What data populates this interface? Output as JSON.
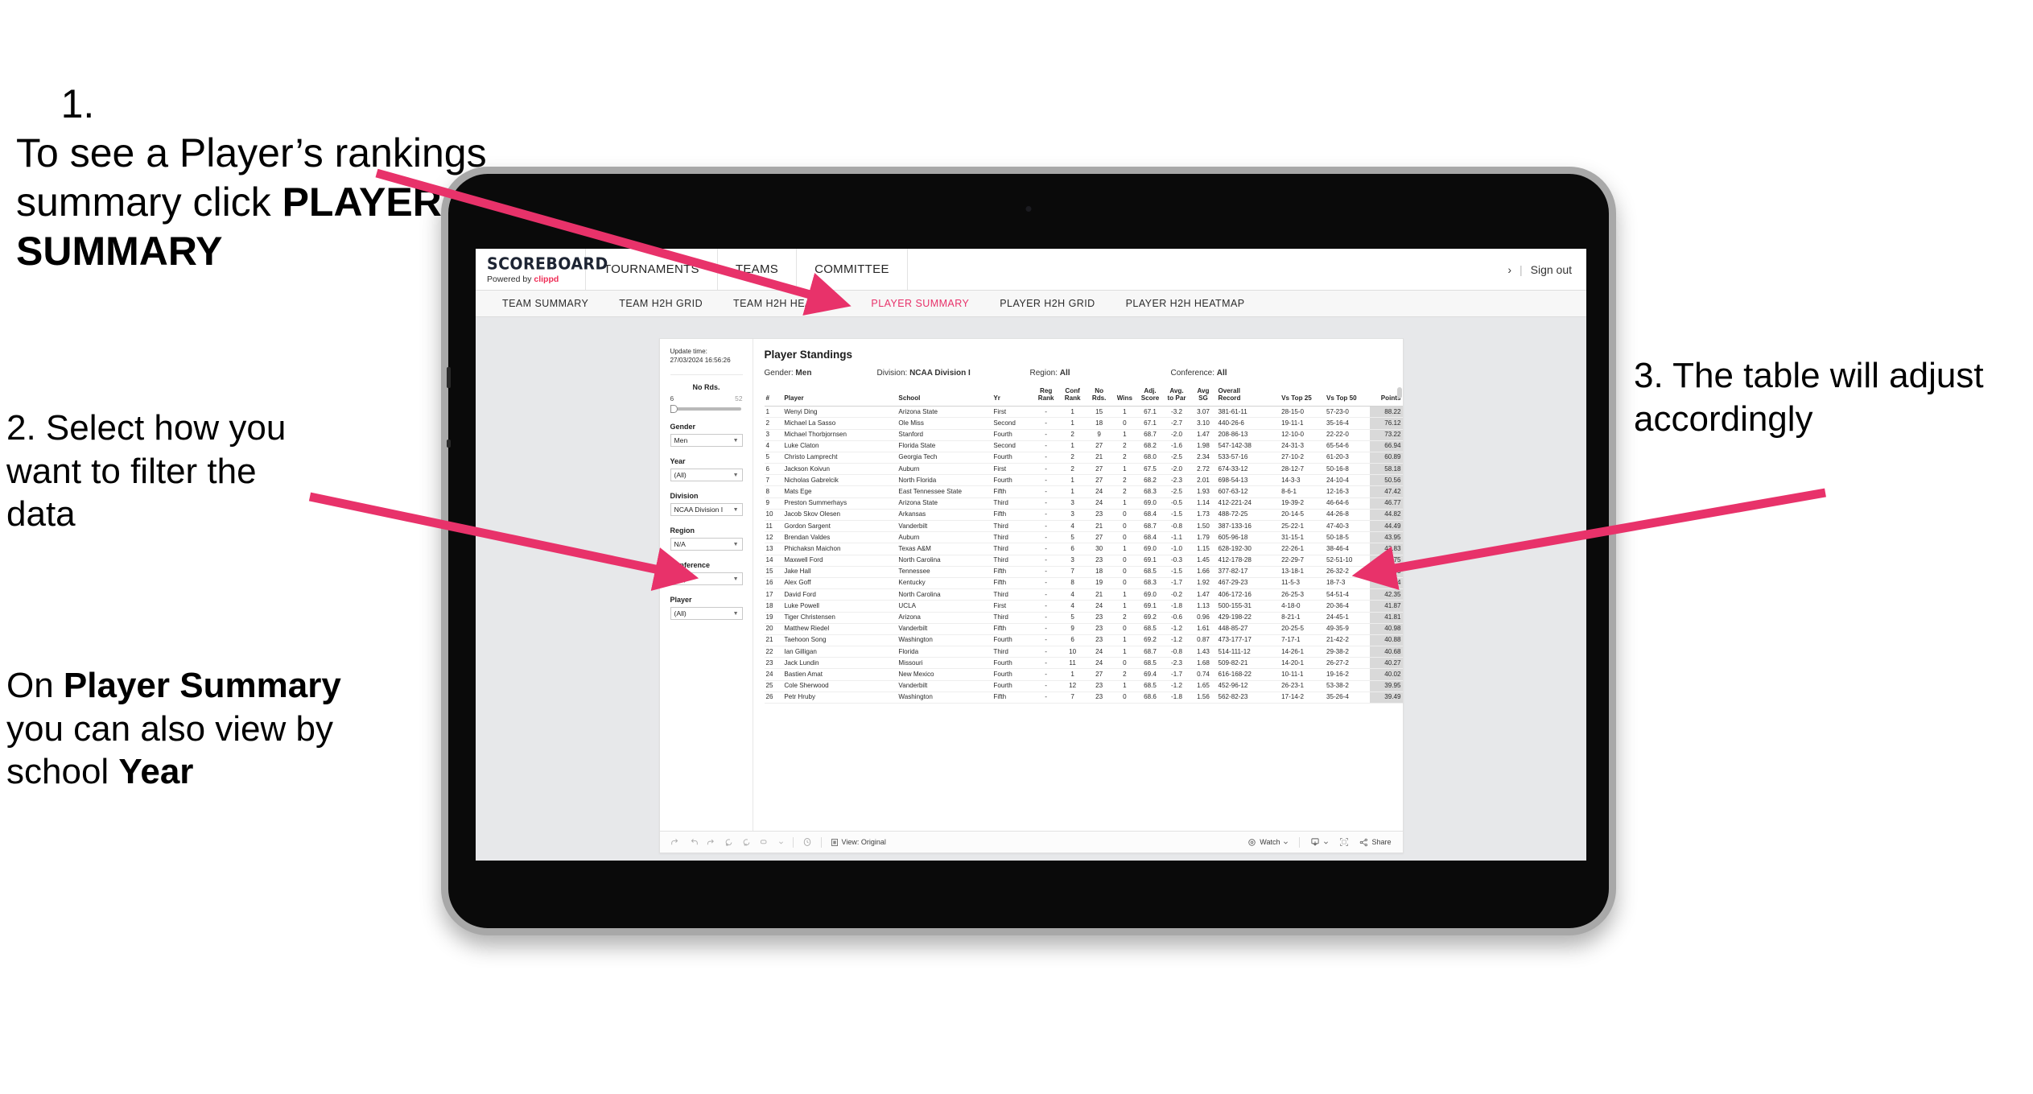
{
  "annotations": {
    "step1_num": "1.",
    "step1_pre": "To see a Player’s rankings summary click ",
    "step1_bold": "PLAYER SUMMARY",
    "step2_pre": "2. Select how you want to filter the data",
    "step2b_a": "On ",
    "step2b_b1": "Player Summary",
    "step2b_c": " you can also view by school ",
    "step2b_b2": "Year",
    "step3": "3. The table will adjust accordingly",
    "arrow_color": "#e8326a"
  },
  "app": {
    "brand_name": "SCOREBOARD",
    "brand_powered_pre": "Powered by ",
    "brand_powered_name": "clippd",
    "brand_accent": "#ef2d56",
    "top_nav": [
      "TOURNAMENTS",
      "TEAMS",
      "COMMITTEE"
    ],
    "account_glyph": "›",
    "account_sep": "|",
    "sign_out": "Sign out",
    "sub_nav": [
      {
        "label": "TEAM SUMMARY",
        "active": false
      },
      {
        "label": "TEAM H2H GRID",
        "active": false
      },
      {
        "label": "TEAM H2H HEATMAP",
        "active": false
      },
      {
        "label": "PLAYER SUMMARY",
        "active": true
      },
      {
        "label": "PLAYER H2H GRID",
        "active": false
      },
      {
        "label": "PLAYER H2H HEATMAP",
        "active": false
      }
    ],
    "active_accent": "#e8326a"
  },
  "filters": {
    "update_label": "Update time:",
    "update_value": "27/03/2024 16:56:26",
    "slider": {
      "label": "No Rds.",
      "min": "6",
      "max": "52"
    },
    "selects": [
      {
        "label": "Gender",
        "value": "Men"
      },
      {
        "label": "Year",
        "value": "(All)"
      },
      {
        "label": "Division",
        "value": "NCAA Division I"
      },
      {
        "label": "Region",
        "value": "N/A"
      },
      {
        "label": "Conference",
        "value": "(All)"
      },
      {
        "label": "Player",
        "value": "(All)"
      }
    ]
  },
  "standings": {
    "title": "Player Standings",
    "meta": [
      {
        "k": "Gender:",
        "v": "Men"
      },
      {
        "k": "Division:",
        "v": "NCAA Division I"
      },
      {
        "k": "Region:",
        "v": "All"
      },
      {
        "k": "Conference:",
        "v": "All"
      }
    ],
    "columns": [
      {
        "l1": "#",
        "l2": ""
      },
      {
        "l1": "Player",
        "l2": ""
      },
      {
        "l1": "School",
        "l2": ""
      },
      {
        "l1": "Yr",
        "l2": ""
      },
      {
        "l1": "Reg",
        "l2": "Rank"
      },
      {
        "l1": "Conf",
        "l2": "Rank"
      },
      {
        "l1": "No",
        "l2": "Rds."
      },
      {
        "l1": "Wins",
        "l2": ""
      },
      {
        "l1": "Adj.",
        "l2": "Score"
      },
      {
        "l1": "Avg.",
        "l2": "to Par"
      },
      {
        "l1": "Avg",
        "l2": "SG"
      },
      {
        "l1": "Overall",
        "l2": "Record"
      },
      {
        "l1": "Vs Top 25",
        "l2": ""
      },
      {
        "l1": "Vs Top 50",
        "l2": ""
      },
      {
        "l1": "Points",
        "l2": ""
      }
    ],
    "rows": [
      [
        "1",
        "Wenyi Ding",
        "Arizona State",
        "First",
        "-",
        "1",
        "15",
        "1",
        "67.1",
        "-3.2",
        "3.07",
        "381-61-11",
        "28-15-0",
        "57-23-0",
        "88.22"
      ],
      [
        "2",
        "Michael La Sasso",
        "Ole Miss",
        "Second",
        "-",
        "1",
        "18",
        "0",
        "67.1",
        "-2.7",
        "3.10",
        "440-26-6",
        "19-11-1",
        "35-16-4",
        "76.12"
      ],
      [
        "3",
        "Michael Thorbjornsen",
        "Stanford",
        "Fourth",
        "-",
        "2",
        "9",
        "1",
        "68.7",
        "-2.0",
        "1.47",
        "208-86-13",
        "12-10-0",
        "22-22-0",
        "73.22"
      ],
      [
        "4",
        "Luke Claton",
        "Florida State",
        "Second",
        "-",
        "1",
        "27",
        "2",
        "68.2",
        "-1.6",
        "1.98",
        "547-142-38",
        "24-31-3",
        "65-54-6",
        "66.94"
      ],
      [
        "5",
        "Christo Lamprecht",
        "Georgia Tech",
        "Fourth",
        "-",
        "2",
        "21",
        "2",
        "68.0",
        "-2.5",
        "2.34",
        "533-57-16",
        "27-10-2",
        "61-20-3",
        "60.89"
      ],
      [
        "6",
        "Jackson Koivun",
        "Auburn",
        "First",
        "-",
        "2",
        "27",
        "1",
        "67.5",
        "-2.0",
        "2.72",
        "674-33-12",
        "28-12-7",
        "50-16-8",
        "58.18"
      ],
      [
        "7",
        "Nicholas Gabrelcik",
        "North Florida",
        "Fourth",
        "-",
        "1",
        "27",
        "2",
        "68.2",
        "-2.3",
        "2.01",
        "698-54-13",
        "14-3-3",
        "24-10-4",
        "50.56"
      ],
      [
        "8",
        "Mats Ege",
        "East Tennessee State",
        "Fifth",
        "-",
        "1",
        "24",
        "2",
        "68.3",
        "-2.5",
        "1.93",
        "607-63-12",
        "8-6-1",
        "12-16-3",
        "47.42"
      ],
      [
        "9",
        "Preston Summerhays",
        "Arizona State",
        "Third",
        "-",
        "3",
        "24",
        "1",
        "69.0",
        "-0.5",
        "1.14",
        "412-221-24",
        "19-39-2",
        "46-64-6",
        "46.77"
      ],
      [
        "10",
        "Jacob Skov Olesen",
        "Arkansas",
        "Fifth",
        "-",
        "3",
        "23",
        "0",
        "68.4",
        "-1.5",
        "1.73",
        "488-72-25",
        "20-14-5",
        "44-26-8",
        "44.82"
      ],
      [
        "11",
        "Gordon Sargent",
        "Vanderbilt",
        "Third",
        "-",
        "4",
        "21",
        "0",
        "68.7",
        "-0.8",
        "1.50",
        "387-133-16",
        "25-22-1",
        "47-40-3",
        "44.49"
      ],
      [
        "12",
        "Brendan Valdes",
        "Auburn",
        "Third",
        "-",
        "5",
        "27",
        "0",
        "68.4",
        "-1.1",
        "1.79",
        "605-96-18",
        "31-15-1",
        "50-18-5",
        "43.95"
      ],
      [
        "13",
        "Phichaksn Maichon",
        "Texas A&M",
        "Third",
        "-",
        "6",
        "30",
        "1",
        "69.0",
        "-1.0",
        "1.15",
        "628-192-30",
        "22-26-1",
        "38-46-4",
        "43.83"
      ],
      [
        "14",
        "Maxwell Ford",
        "North Carolina",
        "Third",
        "-",
        "3",
        "23",
        "0",
        "69.1",
        "-0.3",
        "1.45",
        "412-178-28",
        "22-29-7",
        "52-51-10",
        "42.75"
      ],
      [
        "15",
        "Jake Hall",
        "Tennessee",
        "Fifth",
        "-",
        "7",
        "18",
        "0",
        "68.5",
        "-1.5",
        "1.66",
        "377-82-17",
        "13-18-1",
        "26-32-2",
        "42.55"
      ],
      [
        "16",
        "Alex Goff",
        "Kentucky",
        "Fifth",
        "-",
        "8",
        "19",
        "0",
        "68.3",
        "-1.7",
        "1.92",
        "467-29-23",
        "11-5-3",
        "18-7-3",
        "42.54"
      ],
      [
        "17",
        "David Ford",
        "North Carolina",
        "Third",
        "-",
        "4",
        "21",
        "1",
        "69.0",
        "-0.2",
        "1.47",
        "406-172-16",
        "26-25-3",
        "54-51-4",
        "42.35"
      ],
      [
        "18",
        "Luke Powell",
        "UCLA",
        "First",
        "-",
        "4",
        "24",
        "1",
        "69.1",
        "-1.8",
        "1.13",
        "500-155-31",
        "4-18-0",
        "20-36-4",
        "41.87"
      ],
      [
        "19",
        "Tiger Christensen",
        "Arizona",
        "Third",
        "-",
        "5",
        "23",
        "2",
        "69.2",
        "-0.6",
        "0.96",
        "429-198-22",
        "8-21-1",
        "24-45-1",
        "41.81"
      ],
      [
        "20",
        "Matthew Riedel",
        "Vanderbilt",
        "Fifth",
        "-",
        "9",
        "23",
        "0",
        "68.5",
        "-1.2",
        "1.61",
        "448-85-27",
        "20-25-5",
        "49-35-9",
        "40.98"
      ],
      [
        "21",
        "Taehoon Song",
        "Washington",
        "Fourth",
        "-",
        "6",
        "23",
        "1",
        "69.2",
        "-1.2",
        "0.87",
        "473-177-17",
        "7-17-1",
        "21-42-2",
        "40.88"
      ],
      [
        "22",
        "Ian Gilligan",
        "Florida",
        "Third",
        "-",
        "10",
        "24",
        "1",
        "68.7",
        "-0.8",
        "1.43",
        "514-111-12",
        "14-26-1",
        "29-38-2",
        "40.68"
      ],
      [
        "23",
        "Jack Lundin",
        "Missouri",
        "Fourth",
        "-",
        "11",
        "24",
        "0",
        "68.5",
        "-2.3",
        "1.68",
        "509-82-21",
        "14-20-1",
        "26-27-2",
        "40.27"
      ],
      [
        "24",
        "Bastien Amat",
        "New Mexico",
        "Fourth",
        "-",
        "1",
        "27",
        "2",
        "69.4",
        "-1.7",
        "0.74",
        "616-168-22",
        "10-11-1",
        "19-16-2",
        "40.02"
      ],
      [
        "25",
        "Cole Sherwood",
        "Vanderbilt",
        "Fourth",
        "-",
        "12",
        "23",
        "1",
        "68.5",
        "-1.2",
        "1.65",
        "452-96-12",
        "26-23-1",
        "53-38-2",
        "39.95"
      ],
      [
        "26",
        "Petr Hruby",
        "Washington",
        "Fifth",
        "-",
        "7",
        "23",
        "0",
        "68.6",
        "-1.8",
        "1.56",
        "562-82-23",
        "17-14-2",
        "35-26-4",
        "39.49"
      ]
    ]
  },
  "toolbar": {
    "icons": [
      "undo-icon",
      "redo-icon",
      "revert-icon",
      "refresh-icon",
      "pause-icon",
      "device-icon",
      "dropdown-caret-icon",
      "clock-icon"
    ],
    "view_label": "View: Original",
    "watch_label": "Watch",
    "share_label": "Share"
  }
}
